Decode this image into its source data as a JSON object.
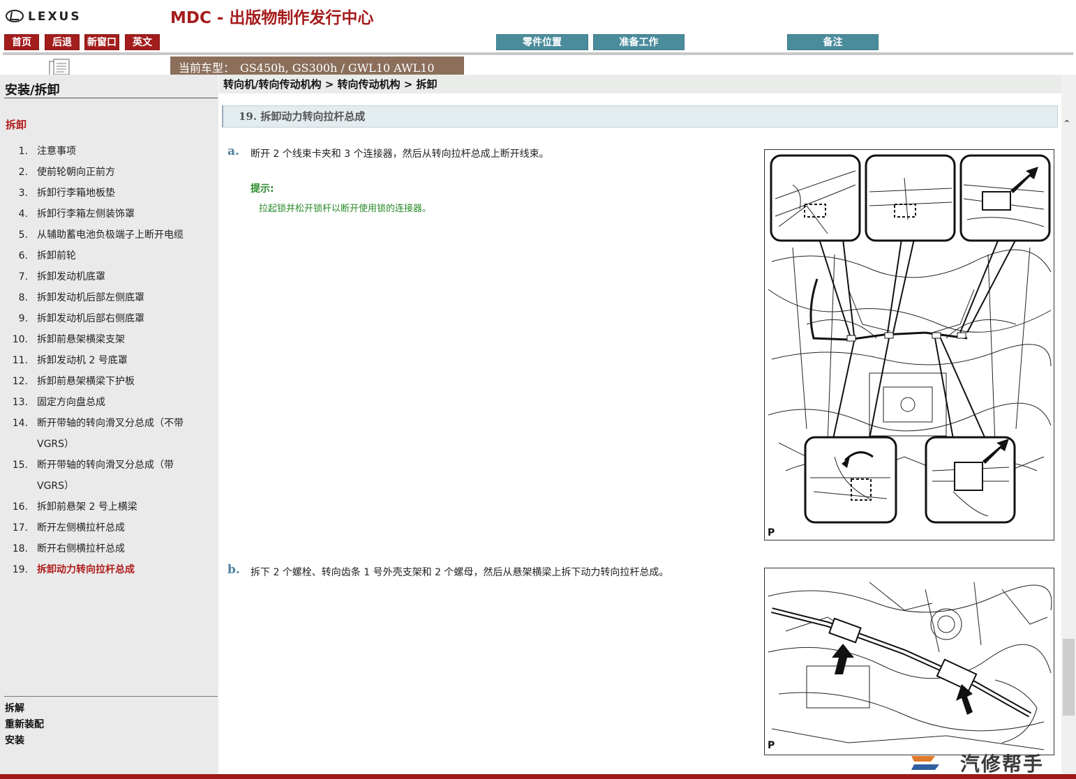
{
  "header": {
    "logo_text": "LEXUS",
    "app_title": "MDC - 出版物制作发行中心",
    "nav_buttons": [
      "首页",
      "后退",
      "新窗口",
      "英文"
    ],
    "tool_buttons": [
      "零件位置",
      "准备工作",
      "备注"
    ],
    "model_label": "当前车型：",
    "model_value": "GS450h, GS300h / GWL10 AWL10"
  },
  "sidebar": {
    "title": "安装/拆卸",
    "section": "拆卸",
    "steps": [
      {
        "num": "1.",
        "label": "注意事项"
      },
      {
        "num": "2.",
        "label": "使前轮朝向正前方"
      },
      {
        "num": "3.",
        "label": "拆卸行李箱地板垫"
      },
      {
        "num": "4.",
        "label": "拆卸行李箱左侧装饰罩"
      },
      {
        "num": "5.",
        "label": "从辅助蓄电池负极端子上断开电缆"
      },
      {
        "num": "6.",
        "label": "拆卸前轮"
      },
      {
        "num": "7.",
        "label": "拆卸发动机底罩"
      },
      {
        "num": "8.",
        "label": "拆卸发动机后部左侧底罩"
      },
      {
        "num": "9.",
        "label": "拆卸发动机后部右侧底罩"
      },
      {
        "num": "10.",
        "label": "拆卸前悬架横梁支架"
      },
      {
        "num": "11.",
        "label": "拆卸发动机 2 号底罩"
      },
      {
        "num": "12.",
        "label": "拆卸前悬架横梁下护板"
      },
      {
        "num": "13.",
        "label": "固定方向盘总成"
      },
      {
        "num": "14.",
        "label": "断开带轴的转向滑叉分总成（不带 VGRS）"
      },
      {
        "num": "15.",
        "label": "断开带轴的转向滑叉分总成（带 VGRS）"
      },
      {
        "num": "16.",
        "label": "拆卸前悬架 2 号上横梁"
      },
      {
        "num": "17.",
        "label": "断开左侧横拉杆总成"
      },
      {
        "num": "18.",
        "label": "断开右侧横拉杆总成"
      },
      {
        "num": "19.",
        "label": "拆卸动力转向拉杆总成"
      }
    ],
    "links": [
      "拆解",
      "重新装配",
      "安装"
    ]
  },
  "main": {
    "breadcrumb": "转向机/转向传动机构 > 转向传动机构 > 拆卸",
    "step_heading": "19. 拆卸动力转向拉杆总成",
    "step_a": {
      "letter": "a.",
      "text": "断开 2 个线束卡夹和 3 个连接器，然后从转向拉杆总成上断开线束。",
      "hint_label": "提示:",
      "hint_text": "拉起锁并松开锁杆以断开使用锁的连接器。",
      "figure_label": "P"
    },
    "step_b": {
      "letter": "b.",
      "text": "拆下 2 个螺栓、转向齿条 1 号外壳支架和 2 个螺母，然后从悬架横梁上拆下动力转向拉杆总成。",
      "figure_label": "P"
    }
  },
  "watermark": "汽修帮手",
  "colors": {
    "brand_red": "#a31d1d",
    "teal": "#4a8c9c",
    "model_tab": "#8b6f5b",
    "hint_green": "#2a8a2a"
  }
}
